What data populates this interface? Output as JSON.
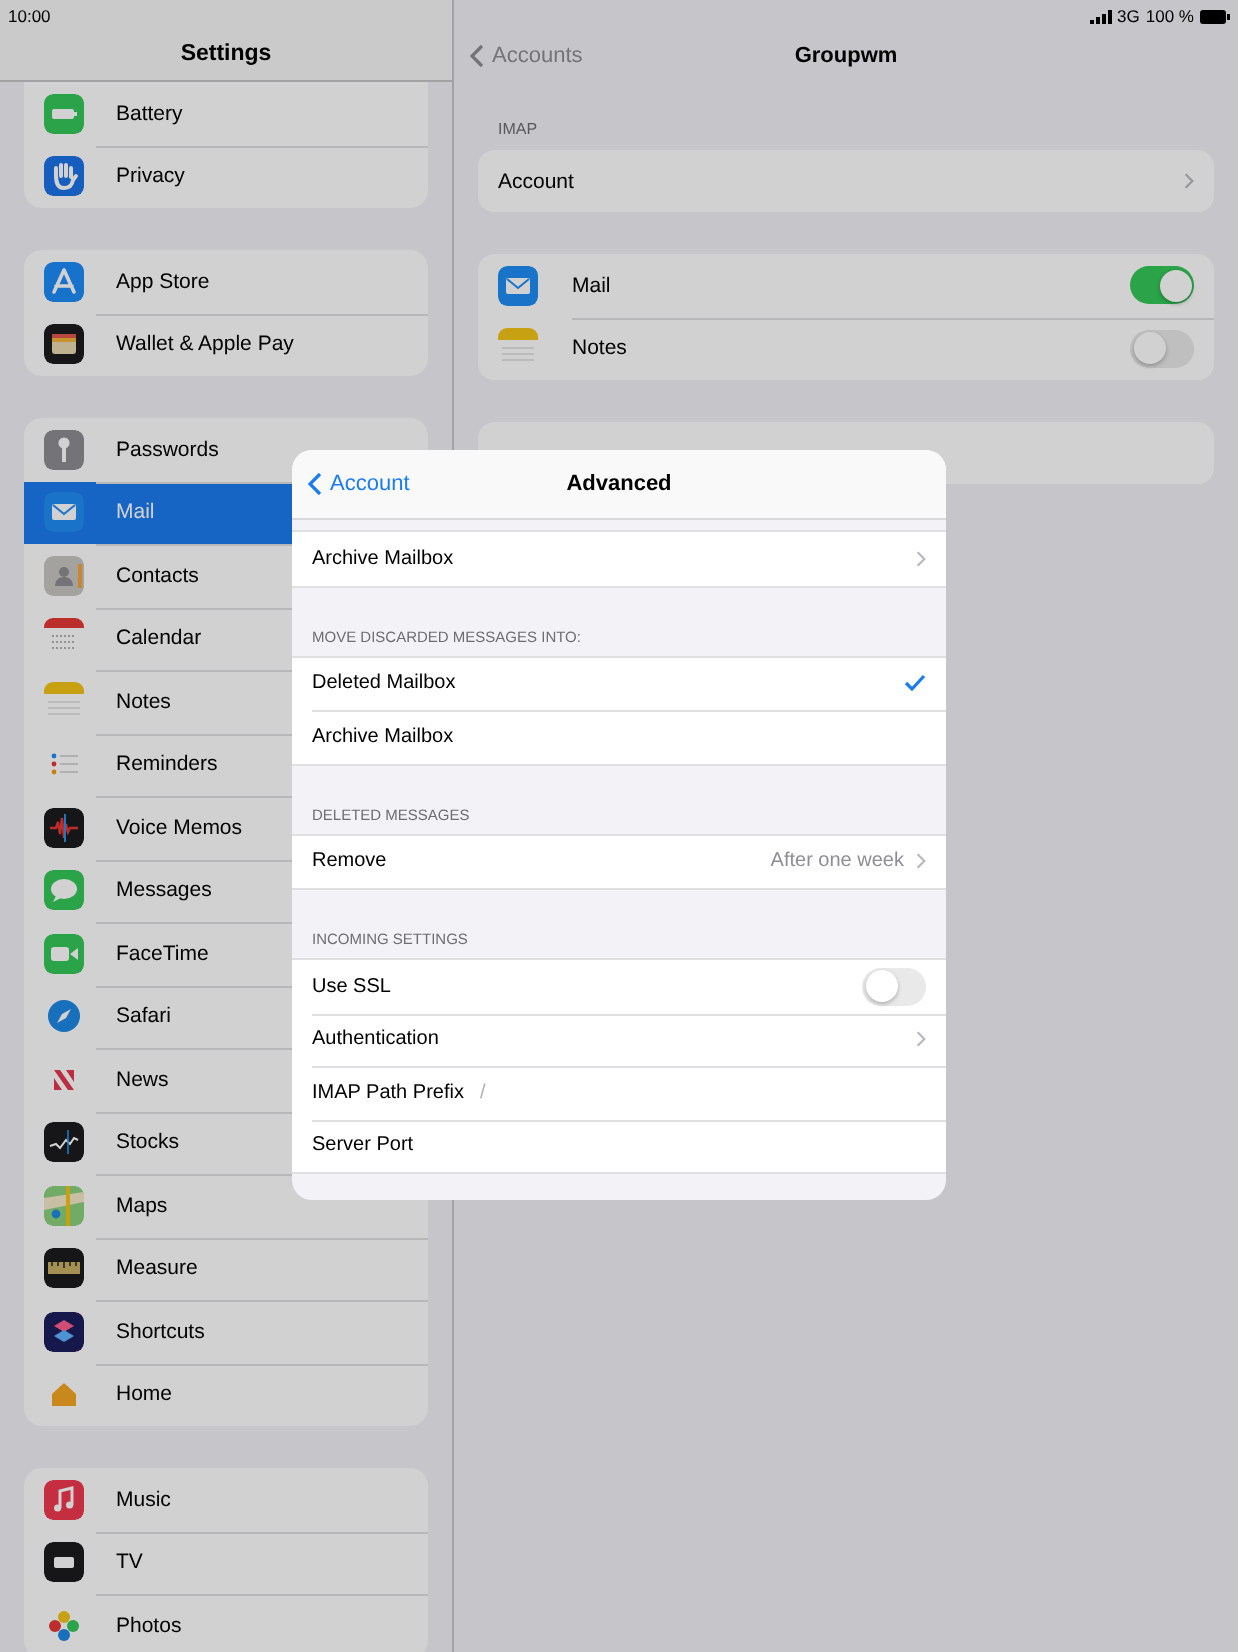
{
  "status_bar": {
    "time": "10:00",
    "network": "3G",
    "battery": "100 %"
  },
  "sidebar": {
    "title": "Settings",
    "groups": [
      {
        "items": [
          {
            "label": "Battery",
            "selected": false
          },
          {
            "label": "Privacy",
            "selected": false
          }
        ]
      },
      {
        "items": [
          {
            "label": "App Store",
            "selected": false
          },
          {
            "label": "Wallet & Apple Pay",
            "selected": false
          }
        ]
      },
      {
        "items": [
          {
            "label": "Passwords",
            "selected": false
          },
          {
            "label": "Mail",
            "selected": true
          },
          {
            "label": "Contacts",
            "selected": false
          },
          {
            "label": "Calendar",
            "selected": false
          },
          {
            "label": "Notes",
            "selected": false
          },
          {
            "label": "Reminders",
            "selected": false
          },
          {
            "label": "Voice Memos",
            "selected": false
          },
          {
            "label": "Messages",
            "selected": false
          },
          {
            "label": "FaceTime",
            "selected": false
          },
          {
            "label": "Safari",
            "selected": false
          },
          {
            "label": "News",
            "selected": false
          },
          {
            "label": "Stocks",
            "selected": false
          },
          {
            "label": "Maps",
            "selected": false
          },
          {
            "label": "Measure",
            "selected": false
          },
          {
            "label": "Shortcuts",
            "selected": false
          },
          {
            "label": "Home",
            "selected": false
          }
        ]
      },
      {
        "items": [
          {
            "label": "Music",
            "selected": false
          },
          {
            "label": "TV",
            "selected": false
          },
          {
            "label": "Photos",
            "selected": false
          }
        ]
      }
    ]
  },
  "detail": {
    "back": "Accounts",
    "title": "Groupwm",
    "section": "IMAP",
    "account_row": "Account",
    "toggles": [
      {
        "label": "Mail",
        "on": true
      },
      {
        "label": "Notes",
        "on": false
      }
    ]
  },
  "modal": {
    "back": "Account",
    "title": "Advanced",
    "sections": [
      {
        "rows": [
          {
            "label": "Archive Mailbox",
            "kind": "nav"
          }
        ]
      },
      {
        "header": "MOVE DISCARDED MESSAGES INTO:",
        "rows": [
          {
            "label": "Deleted Mailbox",
            "kind": "check",
            "selected": true
          },
          {
            "label": "Archive Mailbox",
            "kind": "check",
            "selected": false
          }
        ]
      },
      {
        "header": "DELETED MESSAGES",
        "rows": [
          {
            "label": "Remove",
            "kind": "nav",
            "value": "After one week"
          }
        ]
      },
      {
        "header": "INCOMING SETTINGS",
        "rows": [
          {
            "label": "Use SSL",
            "kind": "toggle",
            "on": false
          },
          {
            "label": "Authentication",
            "kind": "nav"
          },
          {
            "label": "IMAP Path Prefix",
            "kind": "field",
            "value": "/"
          },
          {
            "label": "Server Port",
            "kind": "field"
          }
        ]
      }
    ]
  }
}
